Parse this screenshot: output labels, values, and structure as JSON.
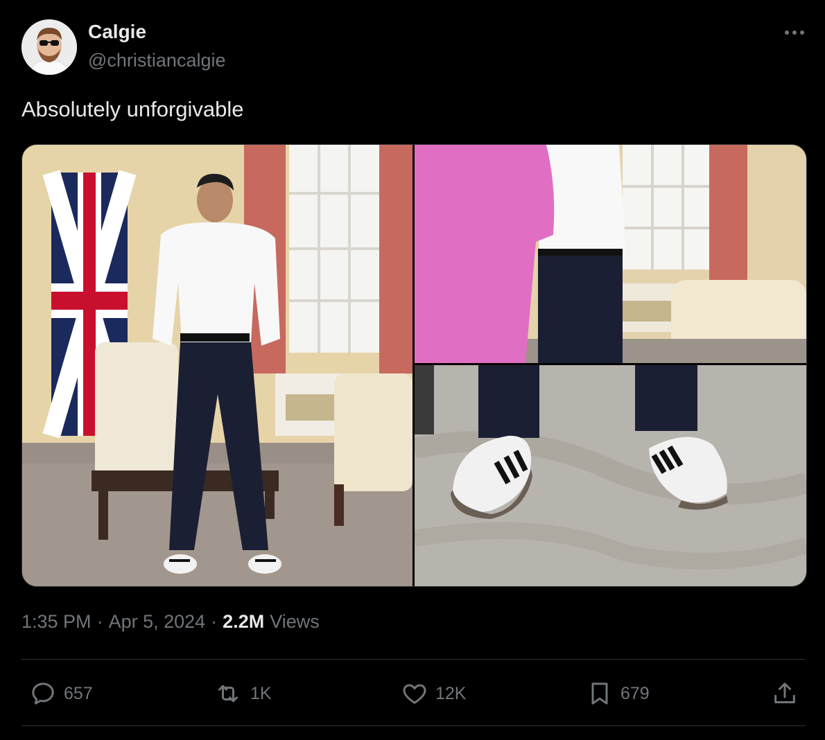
{
  "author": {
    "display_name": "Calgie",
    "handle": "@christiancalgie"
  },
  "tweet": {
    "text": "Absolutely unforgivable",
    "time": "1:35 PM",
    "date": "Apr 5, 2024",
    "views_count": "2.2M",
    "views_label": "Views"
  },
  "media": [
    {
      "description_icon": "photo-man-standing-in-room"
    },
    {
      "description_icon": "photo-legs-and-pink-dress"
    },
    {
      "description_icon": "photo-sneakers-closeup"
    }
  ],
  "actions": {
    "replies": "657",
    "reposts": "1K",
    "likes": "12K",
    "bookmarks": "679"
  },
  "colors": {
    "background": "#000000",
    "primary_text": "#e7e9ea",
    "secondary_text": "#71767b",
    "divider": "#2f3336"
  }
}
